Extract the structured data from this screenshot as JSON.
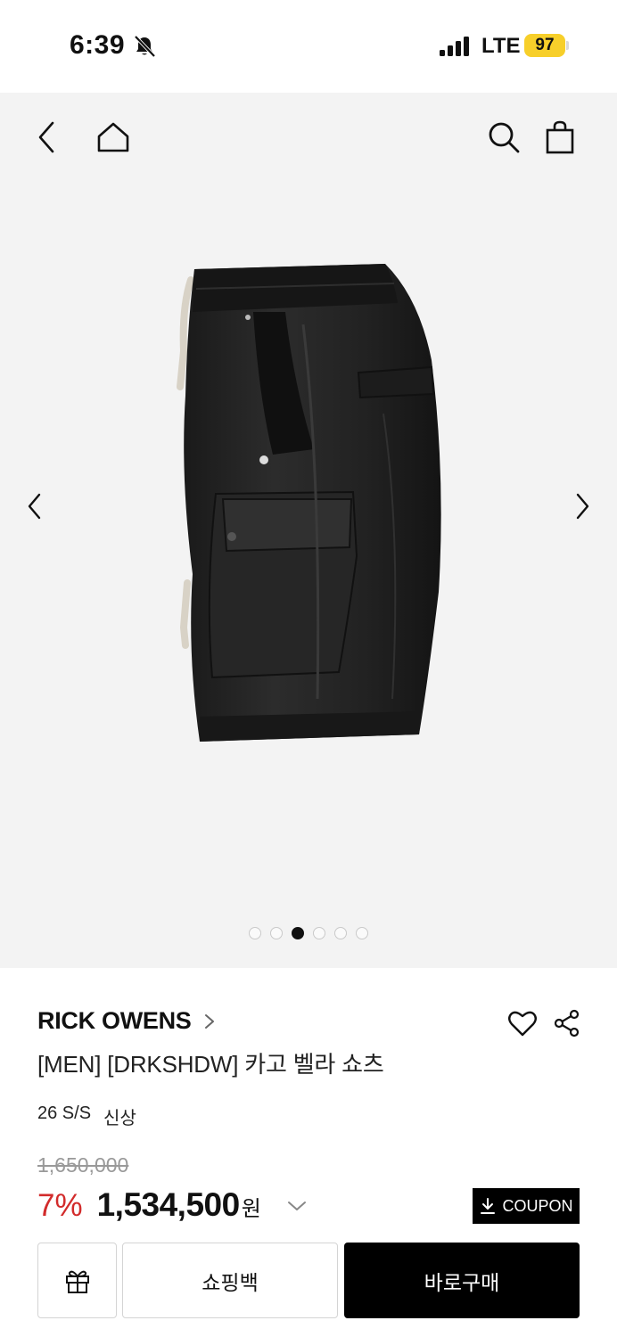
{
  "status_bar": {
    "time": "6:39",
    "network": "LTE",
    "battery": "97"
  },
  "gallery": {
    "image_label": "black cargo shorts",
    "slide_count": 6,
    "active_slide": 3
  },
  "product": {
    "brand": "RICK OWENS",
    "name": "[MEN] [DRKSHDW] 카고 벨라 쇼츠",
    "season": "26 S/S",
    "tag": "신상",
    "original_price": "1,650,000",
    "discount": "7%",
    "sale_price": "1,534,500",
    "currency": "원"
  },
  "actions": {
    "coupon_label": "COUPON",
    "add_to_bag_label": "쇼핑백",
    "buy_now_label": "바로구매"
  },
  "icons": {
    "status": [
      "bell-slash-icon",
      "signal-icon"
    ],
    "header": [
      "back-arrow-icon",
      "home-icon",
      "search-icon",
      "shopping-bag-icon"
    ],
    "gallery": [
      "chevron-left-icon",
      "chevron-right-icon"
    ],
    "product": [
      "heart-icon",
      "share-icon",
      "chevron-down-icon",
      "download-icon",
      "gift-icon"
    ]
  },
  "colors": {
    "discount": "#d22b2b",
    "battery": "#f7cf2a",
    "gallery_bg": "#f3f3f3",
    "primary_button": "#000000"
  }
}
